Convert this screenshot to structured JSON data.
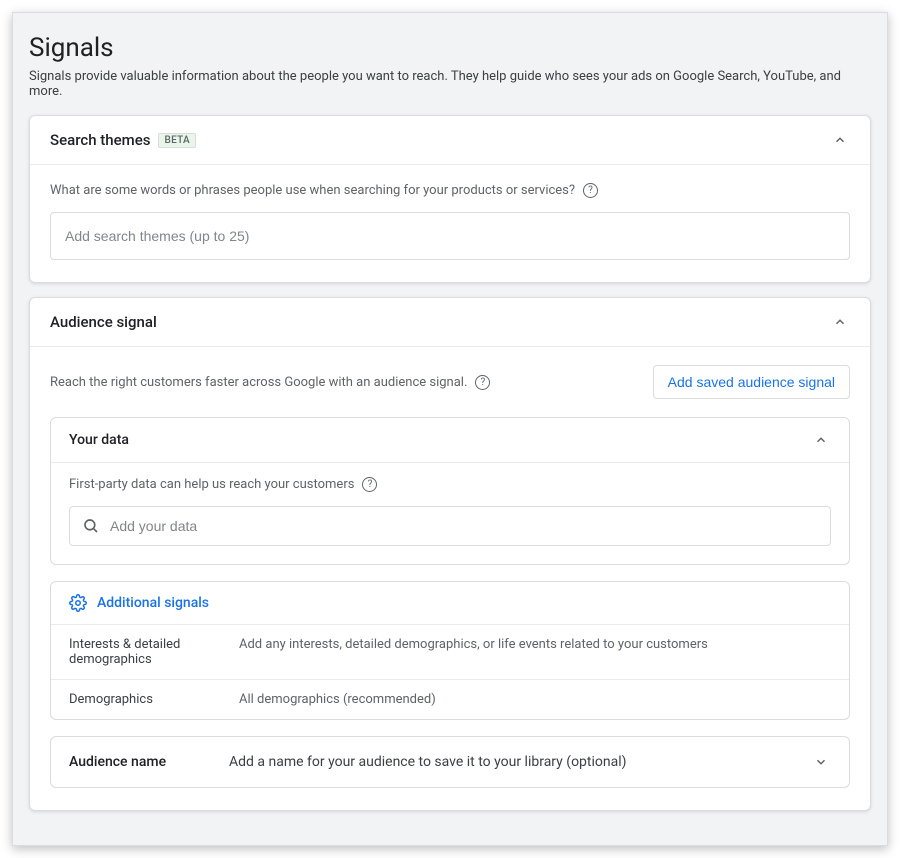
{
  "page": {
    "title": "Signals",
    "description": "Signals provide valuable information about the people you want to reach. They help guide who sees your ads on Google Search, YouTube, and more."
  },
  "searchThemes": {
    "title": "Search themes",
    "badge": "BETA",
    "prompt": "What are some words or phrases people use when searching for your products or services?",
    "placeholder": "Add search themes (up to 25)"
  },
  "audienceSignal": {
    "title": "Audience signal",
    "prompt": "Reach the right customers faster across Google with an audience signal.",
    "addSavedLabel": "Add saved audience signal",
    "yourData": {
      "title": "Your data",
      "prompt": "First-party data can help us reach your customers",
      "placeholder": "Add your data"
    },
    "additional": {
      "title": "Additional signals",
      "rows": [
        {
          "label": "Interests & detailed demographics",
          "value": "Add any interests, detailed demographics, or life events related to your customers"
        },
        {
          "label": "Demographics",
          "value": "All demographics (recommended)"
        }
      ]
    },
    "nameRow": {
      "label": "Audience name",
      "hint": "Add a name for your audience to save it to your library (optional)"
    }
  }
}
